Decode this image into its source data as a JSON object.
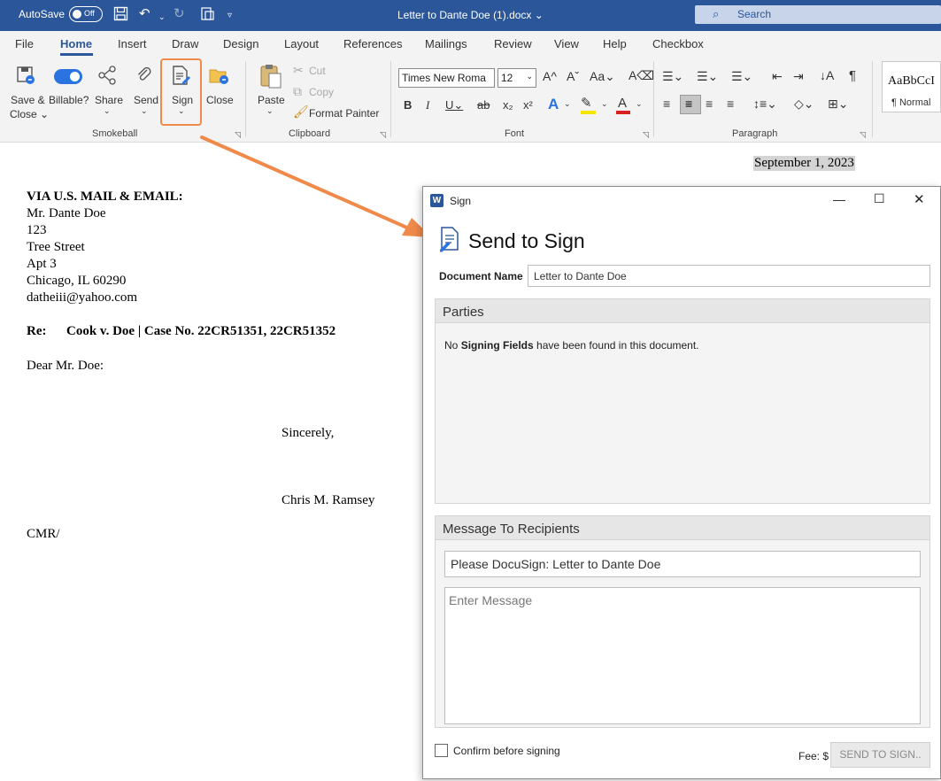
{
  "titlebar": {
    "autosave_label": "AutoSave",
    "autosave_state": "Off",
    "doc_title": "Letter to Dante Doe (1).docx",
    "search_placeholder": "Search"
  },
  "menu": {
    "tabs": [
      "File",
      "Home",
      "Insert",
      "Draw",
      "Design",
      "Layout",
      "References",
      "Mailings",
      "Review",
      "View",
      "Help",
      "Checkbox"
    ],
    "active": "Home"
  },
  "ribbon": {
    "smokeball": {
      "group_label": "Smokeball",
      "save_close_line1": "Save &",
      "save_close_line2": "Close",
      "billable": "Billable?",
      "share": "Share",
      "send": "Send",
      "sign": "Sign",
      "close": "Close"
    },
    "clipboard": {
      "group_label": "Clipboard",
      "paste": "Paste",
      "cut": "Cut",
      "copy": "Copy",
      "format_painter": "Format Painter"
    },
    "font": {
      "group_label": "Font",
      "font_name": "Times New Roma",
      "font_size": "12"
    },
    "paragraph": {
      "group_label": "Paragraph"
    },
    "styles": {
      "sample": "AaBbCcI",
      "name": "¶ Normal"
    }
  },
  "document": {
    "date": "September 1, 2023",
    "delivery": "VIA U.S. MAIL & EMAIL:",
    "address": [
      "Mr. Dante Doe",
      "123",
      "Tree Street",
      "Apt 3",
      "Chicago, IL 60290",
      "datheiii@yahoo.com"
    ],
    "re_label": "Re:",
    "re_text": "Cook v. Doe | Case No. 22CR51351, 22CR51352",
    "salutation": "Dear Mr. Doe:",
    "closing": "Sincerely,",
    "signer": "Chris M. Ramsey",
    "initials": "CMR/"
  },
  "dialog": {
    "window_title": "Sign",
    "heading": "Send to Sign",
    "doc_name_label": "Document Name",
    "doc_name_value": "Letter to Dante Doe",
    "parties": {
      "title": "Parties",
      "msg_prefix": "No ",
      "msg_bold": "Signing Fields",
      "msg_suffix": " have been found in this document."
    },
    "message": {
      "title": "Message To Recipients",
      "subject_value": "Please DocuSign: Letter to Dante Doe",
      "body_placeholder": "Enter Message"
    },
    "confirm_label": "Confirm before signing",
    "fee_label": "Fee: $",
    "send_button": "SEND TO SIGN.."
  },
  "colors": {
    "word_blue": "#2b579a",
    "highlight_orange": "#f08a4b"
  }
}
